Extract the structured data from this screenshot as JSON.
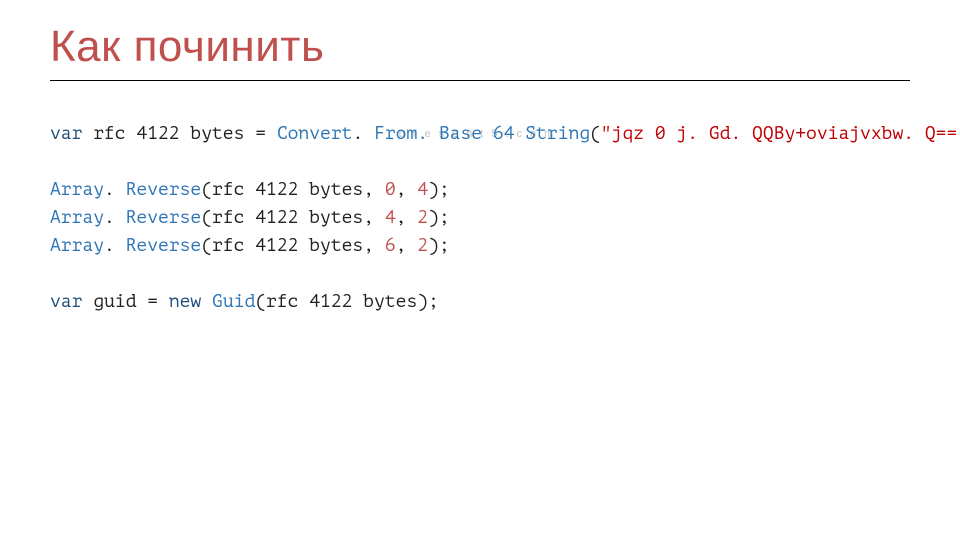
{
  "title": "Как починить",
  "watermark": "present5.com",
  "code": {
    "l1": {
      "kw_var": "var",
      "id_rfc": " rfc 4122 bytes ",
      "eq": "= ",
      "type_convert": "Convert",
      "dot1": ". ",
      "fn_fromb64": "From. Base 64 String",
      "open1": "(",
      "str": "\"jqz 0 j. Gd. QQBy+oviajvxbw. Q==\"",
      "close1": ");"
    },
    "l2": {
      "type_array": "Array",
      "dot": ". ",
      "fn_rev": "Reverse",
      "open": "(rfc 4122 bytes, ",
      "n0": "0",
      "comma": ", ",
      "n4": "4",
      "close": ");"
    },
    "l3": {
      "type_array": "Array",
      "dot": ". ",
      "fn_rev": "Reverse",
      "open": "(rfc 4122 bytes, ",
      "n4": "4",
      "comma": ", ",
      "n2": "2",
      "close": ");"
    },
    "l4": {
      "type_array": "Array",
      "dot": ". ",
      "fn_rev": "Reverse",
      "open": "(rfc 4122 bytes, ",
      "n6": "6",
      "comma": ", ",
      "n2": "2",
      "close": ");"
    },
    "l5": {
      "kw_var": "var",
      "id_guid": " guid ",
      "eq": "= ",
      "kw_new": "new",
      "sp": " ",
      "type_guid": "Guid",
      "open": "(rfc 4122 bytes);"
    }
  }
}
